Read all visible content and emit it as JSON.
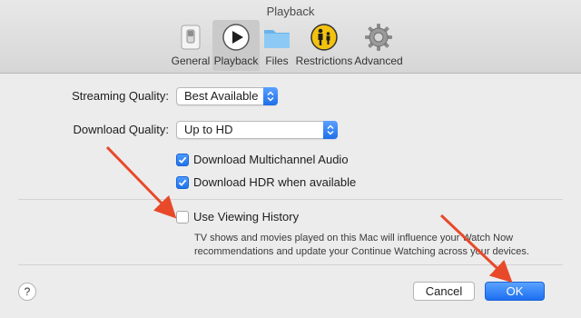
{
  "window": {
    "title": "Playback"
  },
  "tabs": [
    {
      "label": "General",
      "icon": "switch-icon"
    },
    {
      "label": "Playback",
      "icon": "play-icon"
    },
    {
      "label": "Files",
      "icon": "folder-icon"
    },
    {
      "label": "Restrictions",
      "icon": "parental-icon"
    },
    {
      "label": "Advanced",
      "icon": "gear-icon"
    }
  ],
  "form": {
    "streaming_quality_label": "Streaming Quality:",
    "streaming_quality_value": "Best Available",
    "download_quality_label": "Download Quality:",
    "download_quality_value": "Up to HD",
    "multichannel_audio_label": "Download Multichannel Audio",
    "multichannel_audio_checked": true,
    "hdr_label": "Download HDR when available",
    "hdr_checked": true,
    "viewing_history_label": "Use Viewing History",
    "viewing_history_checked": false,
    "viewing_history_desc_line1": "TV shows and movies played on this Mac will influence your Watch Now",
    "viewing_history_desc_line2": "recommendations and update your Continue Watching across your devices."
  },
  "footer": {
    "help_label": "?",
    "cancel_label": "Cancel",
    "ok_label": "OK"
  },
  "colors": {
    "accent": "#1f72ea",
    "arrow": "#e8492a"
  }
}
